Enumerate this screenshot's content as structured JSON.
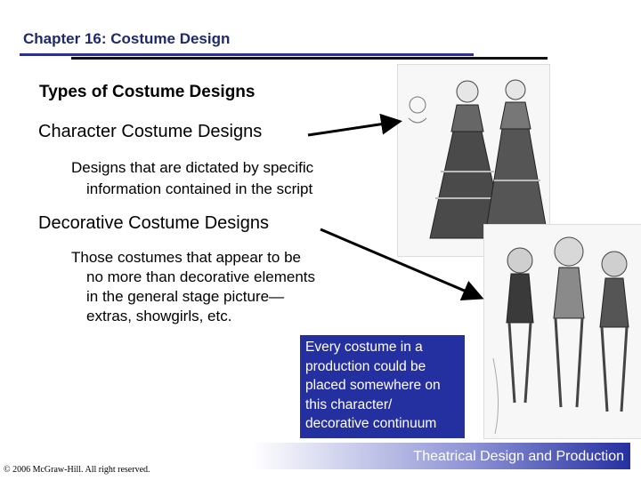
{
  "slide": {
    "chapter_title": "Chapter 16: Costume Design",
    "heading": "Types of Costume Designs",
    "character": {
      "label": "Character Costume Designs",
      "description_line1": "Designs that are dictated by specific",
      "description_line2": "information contained in the script"
    },
    "decorative": {
      "label": "Decorative Costume Designs",
      "description_line1": "Those costumes that appear to be",
      "description_line2": "no more than decorative elements",
      "description_line3": "in the general stage picture—",
      "description_line4": "extras, showgirls, etc."
    },
    "callout": {
      "line1": "Every costume in a",
      "line2": "production could be",
      "line3": "placed somewhere on",
      "line4": "this character/",
      "line5": "decorative continuum"
    },
    "footer_title": "Theatrical Design and Production",
    "copyright": "© 2006 McGraw-Hill. All right reserved."
  },
  "colors": {
    "title_text": "#1f2a6b",
    "title_rule": "#2b2f8f",
    "callout_bg": "#2530a0",
    "footer_gradient_end": "#2530a0"
  },
  "images": {
    "character_sketch": "character-costume-sketch-image",
    "decorative_sketch": "decorative-costume-sketch-image"
  }
}
